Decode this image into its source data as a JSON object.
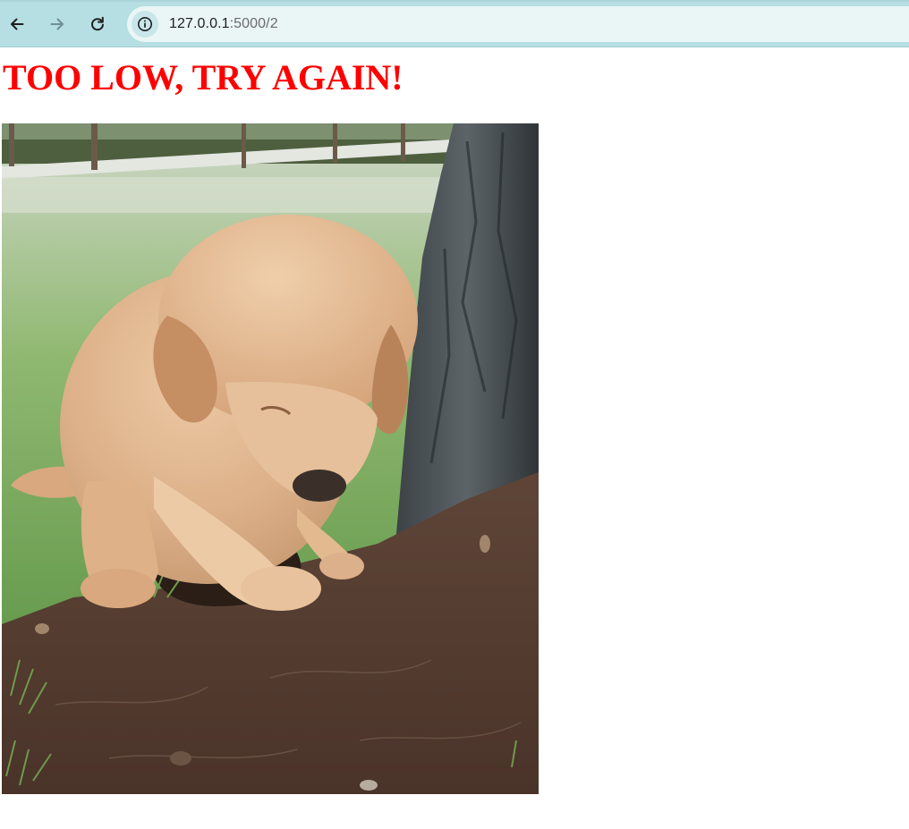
{
  "browser": {
    "url_host": "127.0.0.1",
    "url_path": ":5000/2",
    "back_icon": "back-arrow-icon",
    "forward_icon": "forward-arrow-icon",
    "reload_icon": "reload-icon",
    "site_info_icon": "info-icon"
  },
  "page": {
    "heading": "TOO LOW, TRY AGAIN!",
    "heading_color": "#ff0000",
    "image": {
      "subject": "golden retriever puppy digging in dirt next to a tree trunk",
      "alt": ""
    }
  },
  "colors": {
    "toolbar": "#b6dfe3",
    "omnibox": "#eaf5f6"
  }
}
